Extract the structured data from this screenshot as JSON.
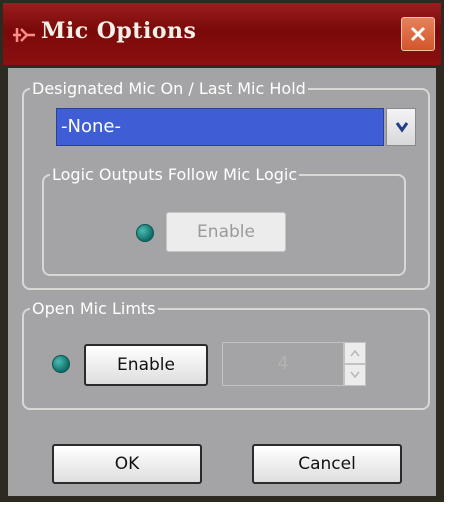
{
  "window": {
    "title": "Mic Options",
    "title_icon": "app-icon",
    "close_icon": "close-icon"
  },
  "designated_mic": {
    "legend": "Designated Mic On / Last Mic Hold",
    "selected": "-None-",
    "arrow_icon": "chevron-down-icon"
  },
  "logic_outputs": {
    "legend": "Logic Outputs Follow Mic Logic",
    "enable_label": "Enable"
  },
  "open_mic_limits": {
    "legend": "Open Mic Limts",
    "enable_label": "Enable",
    "value": "4"
  },
  "buttons": {
    "ok": "OK",
    "cancel": "Cancel"
  }
}
